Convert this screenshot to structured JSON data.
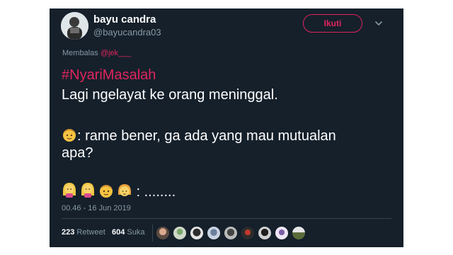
{
  "user": {
    "display_name": "bayu candra",
    "handle": "@bayucandra03"
  },
  "follow_button": {
    "label": "Ikuti"
  },
  "reply": {
    "prefix": "Membalas",
    "mention": "@jek___"
  },
  "tweet": {
    "hashtag": "#NyariMasalah",
    "line1": "Lagi ngelayat ke orang meninggal.",
    "line2": ": rame bener, ga ada yang mau mutualan",
    "line3": "apa?",
    "line4": " : ........"
  },
  "timestamp": "00.46 - 16 Jun 2019",
  "stats": {
    "retweets_count": "223",
    "retweets_label": "Retweet",
    "likes_count": "604",
    "likes_label": "Suka"
  },
  "colors": {
    "background": "#15202b",
    "accent": "#e0245e",
    "muted": "#8899a6"
  },
  "icons": [
    "chevron-down-icon",
    "person-blonde-emoji",
    "woman-blonde-emoji",
    "man-emoji"
  ]
}
